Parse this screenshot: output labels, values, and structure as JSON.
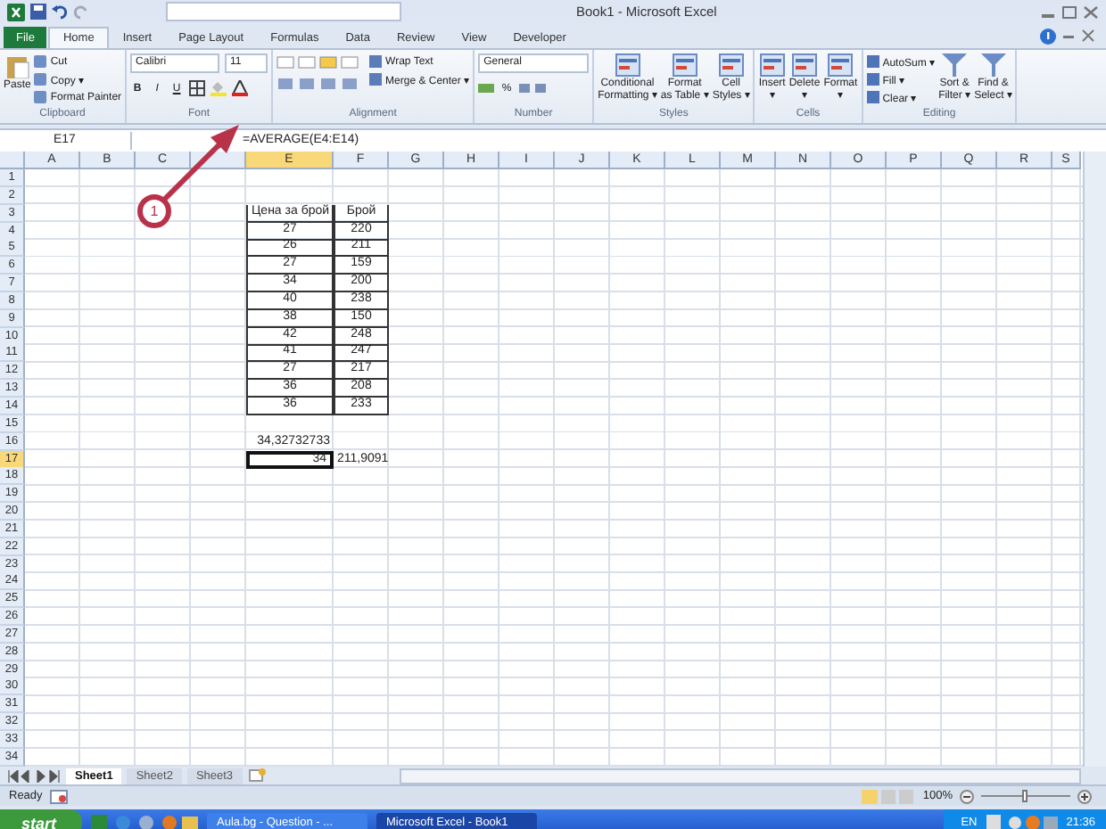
{
  "window": {
    "title": "Book1 - Microsoft Excel"
  },
  "ribbon_tabs": [
    {
      "label": "File",
      "kind": "file",
      "selected": false
    },
    {
      "label": "Home",
      "kind": "tab",
      "selected": true
    },
    {
      "label": "Insert",
      "kind": "tab",
      "selected": false
    },
    {
      "label": "Page Layout",
      "kind": "tab",
      "selected": false
    },
    {
      "label": "Formulas",
      "kind": "tab",
      "selected": false
    },
    {
      "label": "Data",
      "kind": "tab",
      "selected": false
    },
    {
      "label": "Review",
      "kind": "tab",
      "selected": false
    },
    {
      "label": "View",
      "kind": "tab",
      "selected": false
    },
    {
      "label": "Developer",
      "kind": "tab",
      "selected": false
    }
  ],
  "ribbon_groups": [
    {
      "name": "Clipboard",
      "kind": "clipboard",
      "big": "Paste",
      "small": [
        "Cut",
        "Copy ▾",
        "Format Painter"
      ]
    },
    {
      "name": "Font",
      "kind": "font",
      "font": "Calibri",
      "size": "11",
      "styles": [
        "B",
        "I",
        "U"
      ]
    },
    {
      "name": "Alignment",
      "kind": "alignment",
      "small": [
        "Wrap Text",
        "Merge & Center ▾"
      ]
    },
    {
      "name": "Number",
      "kind": "number",
      "format": "General",
      "symbols": [
        "%"
      ]
    },
    {
      "name": "Styles",
      "kind": "big",
      "big_buttons": [
        "Conditional\nFormatting ▾",
        "Format\nas Table ▾",
        "Cell\nStyles ▾"
      ]
    },
    {
      "name": "Cells",
      "kind": "big",
      "big_buttons": [
        "Insert\n▾",
        "Delete\n▾",
        "Format\n▾"
      ]
    },
    {
      "name": "Editing",
      "kind": "editing",
      "small": [
        "AutoSum ▾",
        "Fill ▾",
        "Clear ▾"
      ],
      "big_buttons": [
        "Sort &\nFilter ▾",
        "Find &\nSelect ▾"
      ]
    }
  ],
  "name_box": "E17",
  "formula": "=AVERAGE(E4:E14)",
  "columns": [
    {
      "label": "A",
      "selected": false
    },
    {
      "label": "B",
      "selected": false
    },
    {
      "label": "C",
      "selected": false
    },
    {
      "selected": false
    },
    {
      "label": "E",
      "selected": true
    },
    {
      "label": "F",
      "selected": false
    },
    {
      "label": "G",
      "selected": false
    },
    {
      "label": "H",
      "selected": false
    },
    {
      "label": "I",
      "selected": false
    },
    {
      "label": "J",
      "selected": false
    },
    {
      "label": "K",
      "selected": false
    },
    {
      "label": "L",
      "selected": false
    },
    {
      "label": "M",
      "selected": false
    },
    {
      "label": "N",
      "selected": false
    },
    {
      "label": "O",
      "selected": false
    },
    {
      "label": "P",
      "selected": false
    },
    {
      "label": "Q",
      "selected": false
    },
    {
      "label": "R",
      "selected": false
    },
    {
      "label": "S",
      "selected": false
    }
  ],
  "rows": [
    {
      "number": "1",
      "selected": false
    },
    {
      "number": "2",
      "selected": false
    },
    {
      "number": "3",
      "selected": false,
      "cells": {
        "E": {
          "text": "Цена за брой",
          "bordered": true,
          "selected": false
        },
        "F": {
          "text": "Брой",
          "bordered": true,
          "selected": false
        }
      }
    },
    {
      "number": "4",
      "selected": false,
      "cells": {
        "E": {
          "text": "27",
          "bordered": true,
          "selected": false
        },
        "F": {
          "text": "220",
          "bordered": true,
          "selected": false
        }
      }
    },
    {
      "number": "5",
      "selected": false,
      "cells": {
        "E": {
          "text": "26",
          "bordered": true,
          "selected": false
        },
        "F": {
          "text": "211",
          "bordered": true,
          "selected": false
        }
      }
    },
    {
      "number": "6",
      "selected": false,
      "cells": {
        "E": {
          "text": "27",
          "bordered": true,
          "selected": false
        },
        "F": {
          "text": "159",
          "bordered": true,
          "selected": false
        }
      }
    },
    {
      "number": "7",
      "selected": false,
      "cells": {
        "E": {
          "text": "34",
          "bordered": true,
          "selected": false
        },
        "F": {
          "text": "200",
          "bordered": true,
          "selected": false
        }
      }
    },
    {
      "number": "8",
      "selected": false,
      "cells": {
        "E": {
          "text": "40",
          "bordered": true,
          "selected": false
        },
        "F": {
          "text": "238",
          "bordered": true,
          "selected": false
        }
      }
    },
    {
      "number": "9",
      "selected": false,
      "cells": {
        "E": {
          "text": "38",
          "bordered": true,
          "selected": false
        },
        "F": {
          "text": "150",
          "bordered": true,
          "selected": false
        }
      }
    },
    {
      "number": "10",
      "selected": false,
      "cells": {
        "E": {
          "text": "42",
          "bordered": true,
          "selected": false
        },
        "F": {
          "text": "248",
          "bordered": true,
          "selected": false
        }
      }
    },
    {
      "number": "11",
      "selected": false,
      "cells": {
        "E": {
          "text": "41",
          "bordered": true,
          "selected": false
        },
        "F": {
          "text": "247",
          "bordered": true,
          "selected": false
        }
      }
    },
    {
      "number": "12",
      "selected": false,
      "cells": {
        "E": {
          "text": "27",
          "bordered": true,
          "selected": false
        },
        "F": {
          "text": "217",
          "bordered": true,
          "selected": false
        }
      }
    },
    {
      "number": "13",
      "selected": false,
      "cells": {
        "E": {
          "text": "36",
          "bordered": true,
          "selected": false
        },
        "F": {
          "text": "208",
          "bordered": true,
          "selected": false
        }
      }
    },
    {
      "number": "14",
      "selected": false,
      "cells": {
        "E": {
          "text": "36",
          "bordered": true,
          "selected": false
        },
        "F": {
          "text": "233",
          "bordered": true,
          "selected": false
        }
      }
    },
    {
      "number": "15",
      "selected": false
    },
    {
      "number": "16",
      "selected": false,
      "cells": {
        "E": {
          "text": "34,32732733",
          "bordered": false,
          "selected": false
        }
      }
    },
    {
      "number": "17",
      "selected": true,
      "cells": {
        "E": {
          "text": "34",
          "bordered": false,
          "selected": true
        },
        "F": {
          "text": "211,9091",
          "bordered": false,
          "selected": false
        }
      }
    },
    {
      "number": "18",
      "selected": false
    },
    {
      "number": "19",
      "selected": false
    },
    {
      "number": "20",
      "selected": false
    },
    {
      "number": "21",
      "selected": false
    },
    {
      "number": "22",
      "selected": false
    },
    {
      "number": "23",
      "selected": false
    },
    {
      "number": "24",
      "selected": false
    },
    {
      "number": "25",
      "selected": false
    },
    {
      "number": "26",
      "selected": false
    },
    {
      "number": "27",
      "selected": false
    },
    {
      "number": "28",
      "selected": false
    },
    {
      "number": "29",
      "selected": false
    },
    {
      "number": "30",
      "selected": false
    },
    {
      "number": "31",
      "selected": false
    },
    {
      "number": "32",
      "selected": false
    },
    {
      "number": "33",
      "selected": false
    },
    {
      "number": "34",
      "selected": false
    }
  ],
  "callout": {
    "label": "1"
  },
  "sheet_tabs": [
    {
      "label": "Sheet1",
      "selected": true
    },
    {
      "label": "Sheet2",
      "selected": false
    },
    {
      "label": "Sheet3",
      "selected": false
    }
  ],
  "status_bar": {
    "status": "Ready",
    "zoom": "100%",
    "zoom_slider": {
      "level": 0.5
    }
  },
  "taskbar": {
    "start": "start",
    "tasks": [
      {
        "label": "Aula.bg - Question - ...",
        "selected": false
      },
      {
        "label": "Microsoft Excel - Book1",
        "selected": true
      }
    ],
    "language": "EN",
    "clock": "21:36"
  }
}
